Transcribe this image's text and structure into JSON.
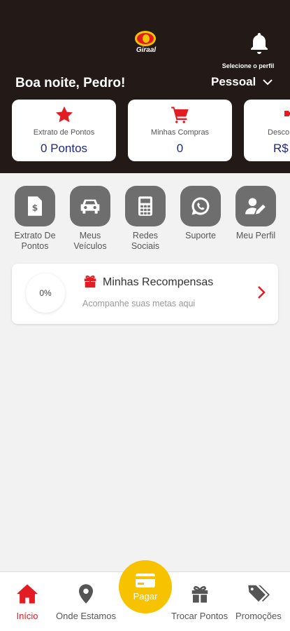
{
  "header": {
    "logo_text": "Giraal",
    "profile_caption": "Selecione o perfil",
    "greeting": "Boa noite, Pedro!",
    "profile_value": "Pessoal"
  },
  "cards": [
    {
      "label": "Extrato de Pontos",
      "value": "0 Pontos",
      "icon": "star-icon"
    },
    {
      "label": "Minhas Compras",
      "value": "0",
      "icon": "cart-icon"
    },
    {
      "label": "Desco",
      "value": "R$",
      "icon": "tag-icon"
    }
  ],
  "actions": [
    {
      "label_line1": "Extrato De",
      "label_line2": "Pontos",
      "icon": "receipt-icon"
    },
    {
      "label_line1": "Meus",
      "label_line2": "Veículos",
      "icon": "car-icon"
    },
    {
      "label_line1": "Redes",
      "label_line2": "Sociais",
      "icon": "calculator-icon"
    },
    {
      "label_line1": "Suporte",
      "label_line2": "",
      "icon": "whatsapp-icon"
    },
    {
      "label_line1": "Meu Perfil",
      "label_line2": "",
      "icon": "user-edit-icon"
    }
  ],
  "rewards": {
    "progress": "0%",
    "title": "Minhas Recompensas",
    "subtitle": "Acompanhe suas metas aqui"
  },
  "nav": {
    "home": "Início",
    "locations": "Onde Estamos",
    "pay": "Pagar",
    "exchange": "Trocar Pontos",
    "promotions": "Promoções"
  },
  "colors": {
    "header_bg": "#231916",
    "accent_red": "#e31c23",
    "pay_yellow": "#f7c300",
    "value_blue": "#1f2a7a"
  }
}
